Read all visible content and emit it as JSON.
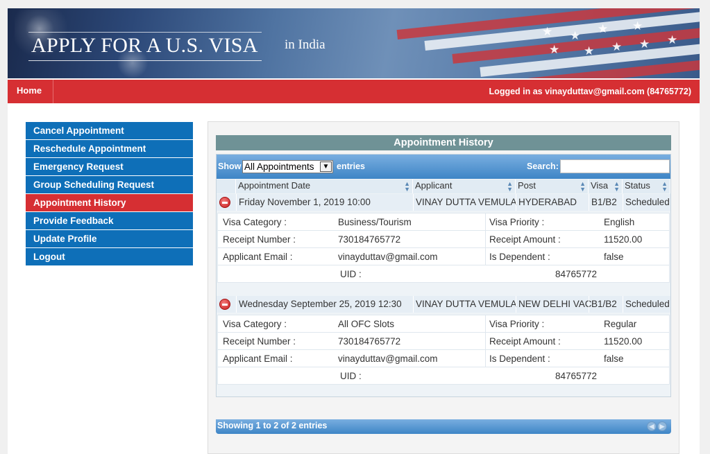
{
  "header": {
    "title": "APPLY FOR A U.S. VISA",
    "subtitle": "in  India"
  },
  "nav": {
    "home": "Home",
    "logged_in_prefix": "Logged in as ",
    "logged_in_user": "vinayduttav@gmail.com (84765772)"
  },
  "sidebar": {
    "items": [
      {
        "label": "Cancel Appointment",
        "active": false
      },
      {
        "label": "Reschedule Appointment",
        "active": false
      },
      {
        "label": "Emergency Request",
        "active": false
      },
      {
        "label": "Group Scheduling Request",
        "active": false
      },
      {
        "label": "Appointment History",
        "active": true
      },
      {
        "label": "Provide Feedback",
        "active": false
      },
      {
        "label": "Update Profile",
        "active": false
      },
      {
        "label": "Logout",
        "active": false
      }
    ]
  },
  "history": {
    "title": "Appointment History",
    "show_label": "Show",
    "show_value": "All Appointments",
    "entries_label": "entries",
    "search_label": "Search:",
    "search_value": "",
    "columns": [
      "Appointment Date",
      "Applicant",
      "Post",
      "Visa",
      "Status"
    ],
    "footer": "Showing 1 to 2 of 2 entries",
    "appointments": [
      {
        "date": "Friday November 1, 2019 10:00",
        "applicant": "VINAY DUTTA VEMULA",
        "post": "HYDERABAD",
        "visa": "B1/B2",
        "status": "Scheduled",
        "details": {
          "visa_category_label": "Visa Category :",
          "visa_category": "Business/Tourism",
          "visa_priority_label": "Visa Priority :",
          "visa_priority": "English",
          "receipt_number_label": "Receipt Number :",
          "receipt_number": "730184765772",
          "receipt_amount_label": "Receipt Amount :",
          "receipt_amount": "11520.00",
          "applicant_email_label": "Applicant Email :",
          "applicant_email": "vinayduttav@gmail.com",
          "is_dependent_label": "Is Dependent :",
          "is_dependent": "false",
          "uid_label": "UID :",
          "uid": "84765772"
        }
      },
      {
        "date": "Wednesday September 25, 2019 12:30",
        "applicant": "VINAY DUTTA VEMULA",
        "post": "NEW DELHI VAC",
        "visa": "B1/B2",
        "status": "Scheduled",
        "details": {
          "visa_category_label": "Visa Category :",
          "visa_category": "All OFC Slots",
          "visa_priority_label": "Visa Priority :",
          "visa_priority": "Regular",
          "receipt_number_label": "Receipt Number :",
          "receipt_number": "730184765772",
          "receipt_amount_label": "Receipt Amount :",
          "receipt_amount": "11520.00",
          "applicant_email_label": "Applicant Email :",
          "applicant_email": "vinayduttav@gmail.com",
          "is_dependent_label": "Is Dependent :",
          "is_dependent": "false",
          "uid_label": "UID :",
          "uid": "84765772"
        }
      }
    ]
  },
  "colors": {
    "nav_red": "#d62f33",
    "menu_blue": "#0e6fb8",
    "title_bar": "#6f9296",
    "toolbar_blue": "#3e85c6"
  }
}
